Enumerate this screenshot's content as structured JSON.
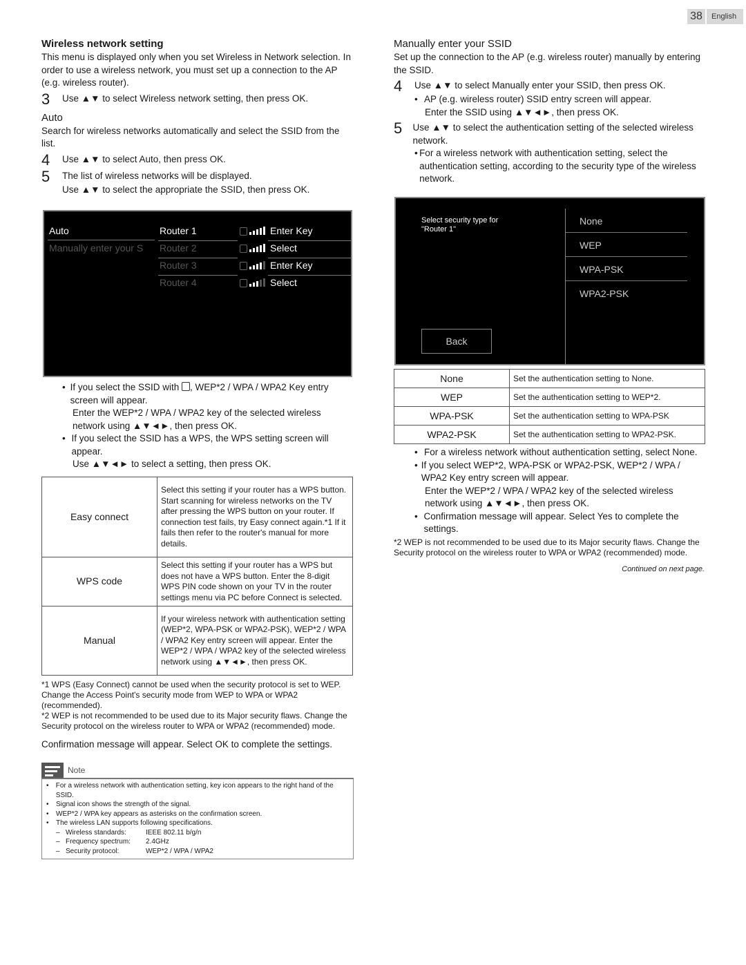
{
  "page": {
    "number": "38",
    "language": "English"
  },
  "left": {
    "title": "Wireless network setting",
    "intro": "This menu is displayed only when you set Wireless in Network selection. In order to use a wireless network, you must set up a connection to the AP (e.g. wireless router).",
    "step3": {
      "n": "3",
      "text": "Use ▲▼ to select Wireless network setting, then press OK."
    },
    "auto_heading": "Auto",
    "auto_desc": "Search for wireless networks automatically and select the SSID from the list.",
    "step4": {
      "n": "4",
      "text": "Use ▲▼ to select Auto, then press OK."
    },
    "step5": {
      "n": "5",
      "text": "The list of wireless networks will be displayed.",
      "sub": "Use ▲▼ to select the appropriate the SSID, then press OK."
    },
    "screen": {
      "menu": [
        "Auto",
        "Manually enter your S"
      ],
      "routers": [
        {
          "name": "Router 1",
          "action": "Enter Key",
          "signal": 5
        },
        {
          "name": "Router 2",
          "action": "Select",
          "signal": 5
        },
        {
          "name": "Router 3",
          "action": "Enter Key",
          "signal": 4
        },
        {
          "name": "Router 4",
          "action": "Select",
          "signal": 3
        }
      ]
    },
    "bullets": [
      "If you select the SSID with [key], WEP*2 / WPA / WPA2 Key entry screen will appear.",
      "If you select the SSID has a WPS, the WPS setting screen will appear."
    ],
    "bullet1_prefix": "If you select the SSID with",
    "bullet1_suffix": ", WEP*2 / WPA / WPA2 Key entry screen will appear.",
    "bullet1_sub": "Enter the WEP*2 / WPA / WPA2 key of the selected wireless network using ▲▼◄►, then press OK.",
    "bullet2": "If you select the SSID has a WPS, the WPS setting screen will appear.",
    "bullet2_sub": "Use ▲▼◄► to select a setting, then press OK.",
    "table": [
      {
        "key": "Easy connect",
        "value": "Select this setting if your router has a WPS button. Start scanning for wireless networks on the TV after pressing the WPS button on your router. If connection test fails, try Easy connect again.*1 If it fails then refer to the router's manual for more details."
      },
      {
        "key": "WPS code",
        "value": "Select this setting if your router has a WPS but does not have a WPS button. Enter the 8-digit WPS PIN code shown on your TV in the router settings menu via PC before Connect is selected."
      },
      {
        "key": "Manual",
        "value": "If your wireless network with authentication setting (WEP*2, WPA-PSK or WPA2-PSK), WEP*2 / WPA / WPA2 Key entry screen will appear. Enter the WEP*2 / WPA / WPA2 key of the selected wireless network using ▲▼◄►, then press OK."
      }
    ],
    "footnotes": [
      "*1 WPS (Easy Connect) cannot be used when the security protocol is set to WEP. Change the Access Point's security mode from WEP to WPA or WPA2 (recommended).",
      "*2 WEP is not recommended to be used due to its Major security flaws. Change the Security protocol on the wireless router to WPA or WPA2 (recommended) mode."
    ],
    "confirm": "Confirmation message will appear. Select OK to complete the settings.",
    "note": {
      "title": "Note",
      "items": [
        "For a wireless network with authentication setting, key icon appears to the right hand of the SSID.",
        "Signal icon shows the strength of the signal.",
        "WEP*2 / WPA key appears as asterisks on the confirmation screen.",
        "The wireless LAN supports following specifications."
      ],
      "specs": [
        {
          "label": "Wireless standards:",
          "value": "IEEE 802.11 b/g/n"
        },
        {
          "label": "Frequency spectrum:",
          "value": "2.4GHz"
        },
        {
          "label": "Security protocol:",
          "value": "WEP*2 / WPA / WPA2"
        }
      ]
    }
  },
  "right": {
    "title": "Manually enter your SSID",
    "intro": "Set up the connection to the AP (e.g. wireless router) manually by entering the SSID.",
    "step4": {
      "n": "4",
      "text": "Use ▲▼ to select Manually enter your SSID, then press OK."
    },
    "step4_bullet": "AP (e.g. wireless router) SSID entry screen will appear.",
    "step4_sub": "Enter the SSID using ▲▼◄►, then press OK.",
    "step5": {
      "n": "5",
      "text": "Use ▲▼ to select the authentication setting of the selected wireless network."
    },
    "step5_bullet": "For a wireless network with authentication setting, select the authentication setting, according to the security type of the wireless network.",
    "screen": {
      "prompt": "Select security type for \"Router 1\"",
      "options": [
        "None",
        "WEP",
        "WPA-PSK",
        "WPA2-PSK"
      ],
      "back": "Back"
    },
    "table": [
      {
        "key": "None",
        "value": "Set the authentication setting to None."
      },
      {
        "key": "WEP",
        "value": "Set the authentication setting to WEP*2."
      },
      {
        "key": "WPA-PSK",
        "value": "Set the authentication setting to WPA-PSK"
      },
      {
        "key": "WPA2-PSK",
        "value": "Set the authentication setting to WPA2-PSK."
      }
    ],
    "bullets": [
      "For a wireless network without authentication setting, select None.",
      "If you select WEP*2, WPA-PSK or WPA2-PSK, WEP*2 / WPA / WPA2 Key entry screen will appear.",
      "Confirmation message will appear. Select Yes to complete the settings."
    ],
    "bullet2_sub": "Enter the WEP*2 / WPA / WPA2 key of the selected wireless network using ▲▼◄►, then press OK.",
    "footnote": "*2 WEP is not recommended to be used due to its Major security flaws. Change the Security protocol on the wireless router to WPA or WPA2 (recommended) mode.",
    "continued": "Continued on next page."
  }
}
